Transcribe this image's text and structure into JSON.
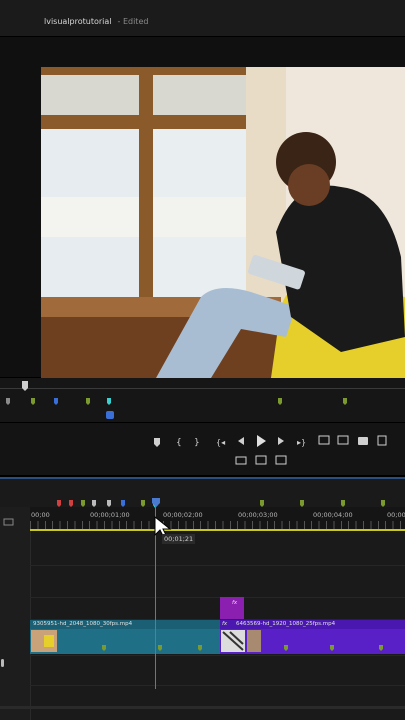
{
  "header": {
    "project_title": "lvisualprotutorial",
    "status": "- Edited"
  },
  "program_monitor": {
    "content": "video frame: woman seated in yellow chair by window, writing in notebook while on phone"
  },
  "transport": {
    "buttons": [
      "add-marker",
      "mark-in",
      "mark-out",
      "go-to-in",
      "step-back",
      "play",
      "step-forward",
      "go-to-out",
      "lift",
      "extract",
      "export-frame",
      "comparison-view",
      "proxy-toggle",
      "insert",
      "overwrite"
    ]
  },
  "timeline": {
    "timecodes": [
      "00;00",
      "00;00;01;00",
      "00;00;02;00",
      "00;00;03;00",
      "00;00;04;00",
      "00;00"
    ],
    "playhead_tooltip": "00;01;21",
    "clips": {
      "clip1_name": "9305951-hd_2048_1080_30fps.mp4",
      "clip2_name": "6463569-hd_1920_1080_25fps.mp4",
      "fx_label": "fx"
    },
    "colors": {
      "clip1": "#1f6f86",
      "clip2": "#5a20c8",
      "fx_clip": "#8a1fb0",
      "playhead": "#4a7ad0",
      "workarea": "#c8c820"
    }
  }
}
